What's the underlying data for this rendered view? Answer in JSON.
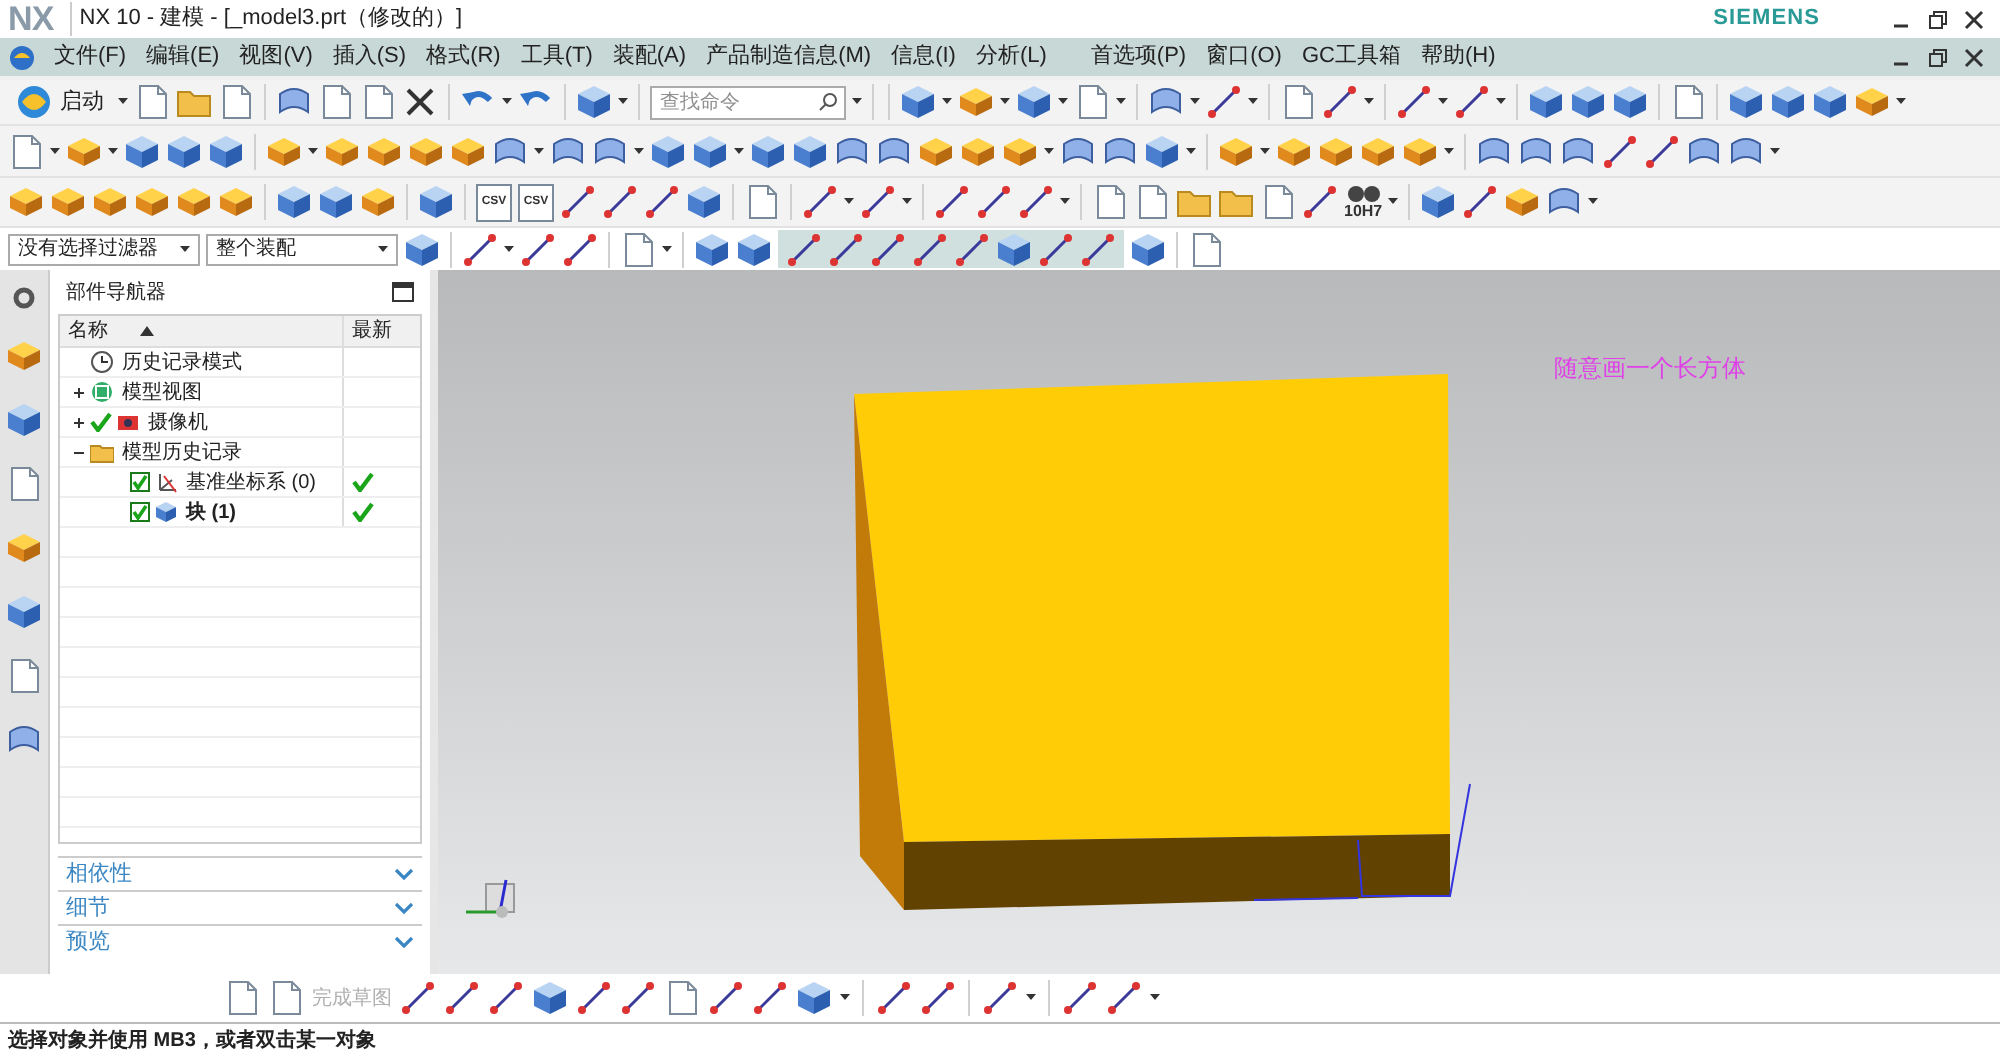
{
  "window": {
    "logo": "NX",
    "title": "NX 10 - 建模 - [_model3.prt（修改的）]",
    "brand": "SIEMENS"
  },
  "menu": [
    "文件(F)",
    "编辑(E)",
    "视图(V)",
    "插入(S)",
    "格式(R)",
    "工具(T)",
    "装配(A)",
    "产品制造信息(M)",
    "信息(I)",
    "分析(L)",
    "首选项(P)",
    "窗口(O)",
    "GC工具箱",
    "帮助(H)"
  ],
  "toolbar_row_1": [
    {
      "kind": "button",
      "label": "启动"
    },
    {
      "kind": "search",
      "placeholder": "查找命令"
    }
  ],
  "toolbar_row_3": [
    {
      "kind": "file_icon",
      "label": "CSV"
    },
    {
      "kind": "file_icon",
      "label": "CSV"
    },
    {
      "kind": "icon_caption",
      "label": "10H7"
    }
  ],
  "selection_bar": [
    {
      "kind": "select",
      "value": "没有选择过滤器"
    },
    {
      "kind": "select",
      "value": "整个装配"
    }
  ],
  "navigator": {
    "title": "部件导航器",
    "columns": [
      "名称",
      "最新"
    ],
    "tree": [
      {
        "label": "历史记录模式",
        "kind": "clock"
      },
      {
        "label": "模型视图",
        "kind": "views",
        "expanded": false
      },
      {
        "label": "摄像机",
        "kind": "camera",
        "expanded": false,
        "checkmark": true
      },
      {
        "label": "模型历史记录",
        "kind": "folder",
        "expanded": true,
        "children": [
          {
            "label": "基准坐标系 (0)",
            "kind": "csys",
            "checked": true,
            "latest": true,
            "current": false
          },
          {
            "label": "块 (1)",
            "kind": "block",
            "checked": true,
            "latest": true,
            "current": true
          }
        ]
      }
    ],
    "panels": [
      "相依性",
      "细节",
      "预览"
    ]
  },
  "viewport": {
    "note": "随意画一个长方体"
  },
  "sketch_toolbar": [
    {
      "kind": "label",
      "text": "完成草图",
      "disabled": true
    }
  ],
  "status_bar": {
    "message": "选择对象并使用 MB3，或者双击某一对象"
  }
}
